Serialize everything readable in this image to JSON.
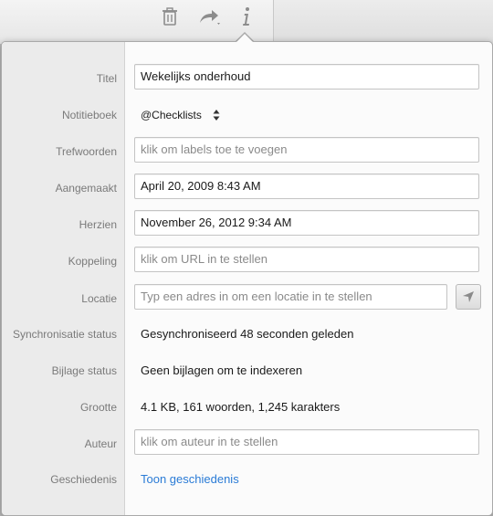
{
  "toolbar": {
    "icons": [
      "trash-icon",
      "share-icon",
      "info-icon"
    ]
  },
  "fields": {
    "title": {
      "label": "Titel",
      "value": "Wekelijks onderhoud"
    },
    "notebook": {
      "label": "Notitieboek",
      "value": "@Checklists"
    },
    "tags": {
      "label": "Trefwoorden",
      "placeholder": "klik om labels toe te voegen"
    },
    "created": {
      "label": "Aangemaakt",
      "value": "April 20, 2009 8:43 AM"
    },
    "updated": {
      "label": "Herzien",
      "value": "November 26, 2012 9:34 AM"
    },
    "link": {
      "label": "Koppeling",
      "placeholder": "klik om URL in te stellen"
    },
    "location": {
      "label": "Locatie",
      "placeholder": "Typ een adres in om een locatie in te stellen"
    },
    "sync": {
      "label": "Synchronisatie status",
      "value": "Gesynchroniseerd 48 seconden geleden"
    },
    "attachments": {
      "label": "Bijlage status",
      "value": "Geen bijlagen om te indexeren"
    },
    "size": {
      "label": "Grootte",
      "value": "4.1 KB, 161 woorden, 1,245 karakters"
    },
    "author": {
      "label": "Auteur",
      "placeholder": "klik om auteur in te stellen"
    },
    "history": {
      "label": "Geschiedenis",
      "link": "Toon geschiedenis"
    }
  },
  "colors": {
    "link": "#2a7bd6",
    "label_text": "#7a7a7a",
    "label_column": "#ebebeb"
  }
}
